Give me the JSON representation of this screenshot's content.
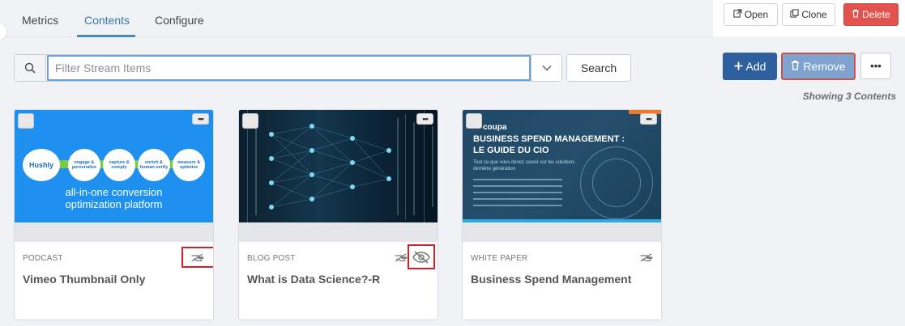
{
  "tabs": [
    {
      "label": "Metrics"
    },
    {
      "label": "Contents",
      "active": true
    },
    {
      "label": "Configure"
    }
  ],
  "top_actions": {
    "open": "Open",
    "clone": "Clone",
    "delete": "Delete"
  },
  "search": {
    "placeholder": "Filter Stream Items",
    "value": "",
    "button": "Search"
  },
  "toolbar": {
    "add": "Add",
    "remove": "Remove",
    "more": "•••"
  },
  "showing": "Showing 3 Contents",
  "cards": [
    {
      "type": "PODCAST",
      "title": "Vimeo Thumbnail Only",
      "thumb": {
        "logo": "Hushly",
        "steps": [
          "engage & personalize",
          "capture & comply",
          "enrich & human-verify",
          "measure & optimize"
        ],
        "caption_line1": "all-in-one conversion",
        "caption_line2": "optimization platform"
      },
      "icons": [
        "hand-icon"
      ]
    },
    {
      "type": "BLOG POST",
      "title": "What is Data Science?-R",
      "icons": [
        "hand-icon",
        "eye-slash-icon"
      ]
    },
    {
      "type": "WHITE PAPER",
      "title": "Business Spend Management",
      "thumb": {
        "brand": "coupa",
        "headline_line1": "BUSINESS SPEND MANAGEMENT :",
        "headline_line2": "LE GUIDE DU CIO",
        "sub": "Tout ce que vous devez savoir sur les solutions dernière génération"
      },
      "icons": [
        "hand-icon"
      ]
    }
  ],
  "colors": {
    "accent": "#3a79a6",
    "add": "#2e5f9e",
    "remove": "#7fa2cf",
    "delete": "#e0534f",
    "highlight": "#d0222a"
  }
}
